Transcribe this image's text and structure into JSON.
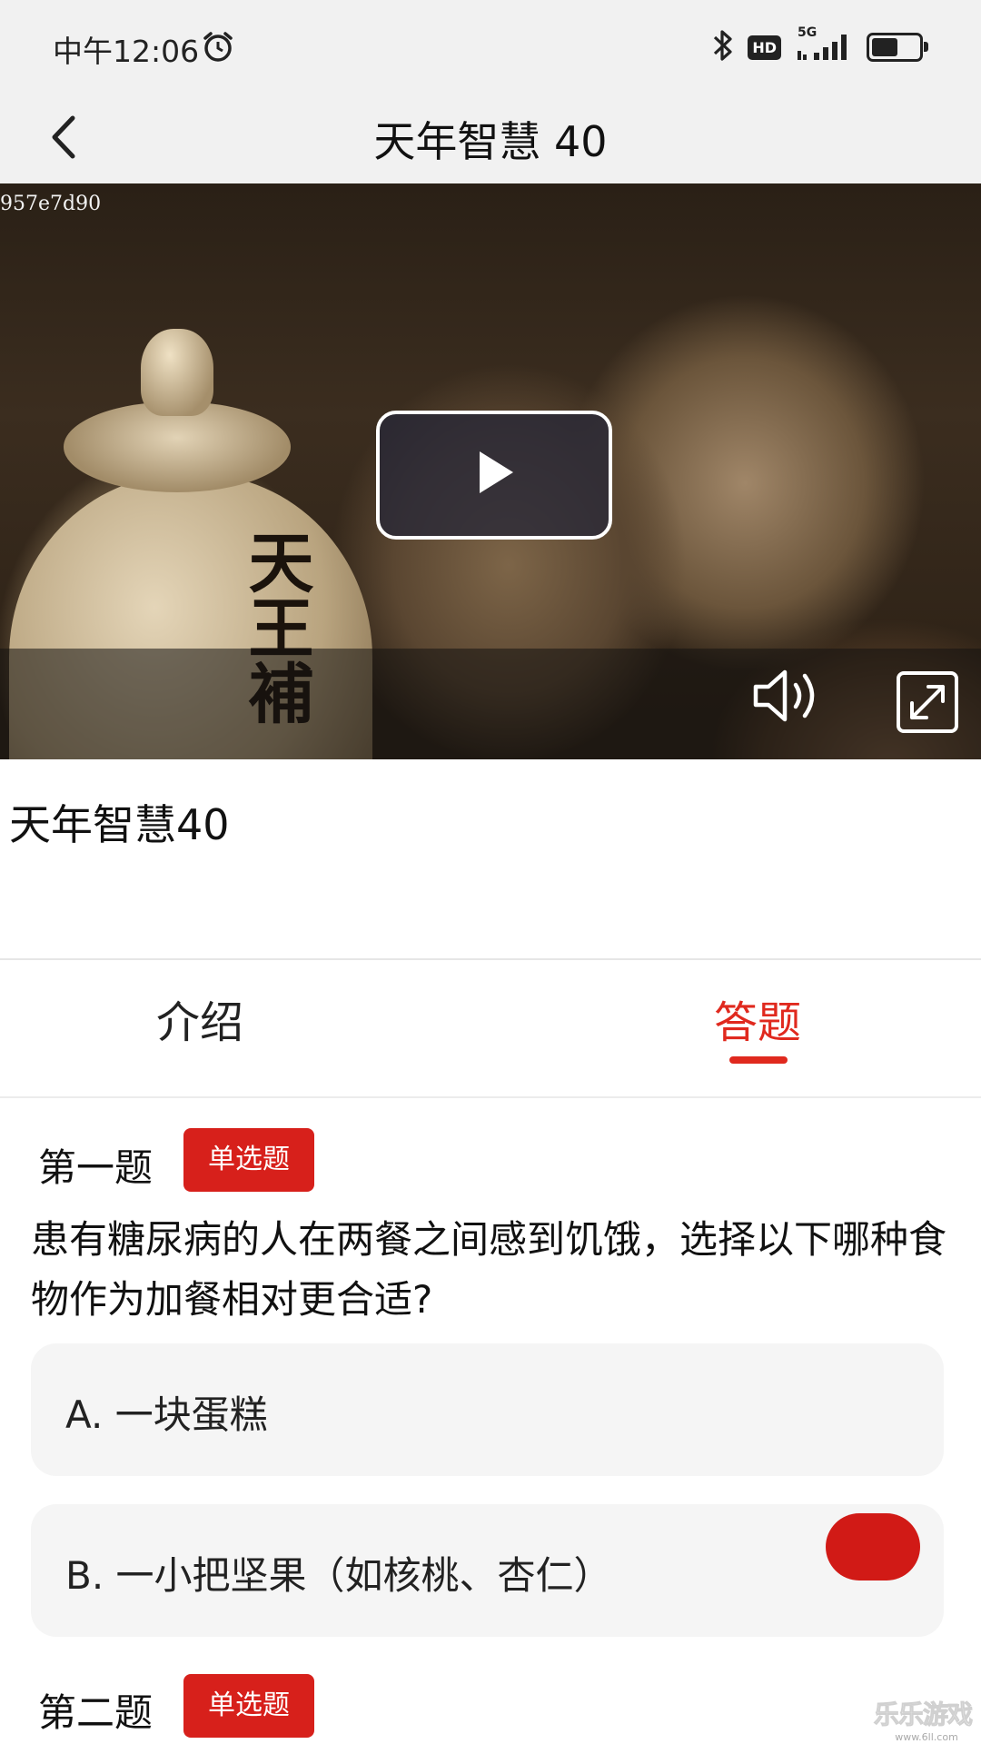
{
  "status_bar": {
    "time": "中午12:06",
    "hd": "HD",
    "network": "5G",
    "icons": [
      "alarm-icon",
      "bluetooth-icon",
      "hd-icon",
      "signal-5g-icon",
      "battery-icon"
    ],
    "battery_level": 0.55
  },
  "header": {
    "title": "天年智慧 40",
    "back_icon": "chevron-left-icon"
  },
  "video": {
    "overlay_code": "957e7d90",
    "jar_text": "天王補",
    "play_icon": "play-icon",
    "volume_icon": "volume-icon",
    "fullscreen_icon": "fullscreen-icon"
  },
  "video_title": "天年智慧40",
  "tabs": [
    {
      "label": "介绍",
      "active": false
    },
    {
      "label": "答题",
      "active": true
    }
  ],
  "questions": [
    {
      "number_label": "第一题",
      "type_badge": "单选题",
      "text": "患有糖尿病的人在两餐之间感到饥饿，选择以下哪种食物作为加餐相对更合适?",
      "options": [
        {
          "label": "A. 一块蛋糕",
          "selected": false
        },
        {
          "label": "B. 一小把坚果（如核桃、杏仁）",
          "selected": true
        }
      ]
    },
    {
      "number_label": "第二题",
      "type_badge": "单选题"
    }
  ],
  "watermark": {
    "text": "乐乐游戏",
    "sub": "www.6ll.com"
  },
  "colors": {
    "accent": "#e0291e",
    "badge": "#d7201b",
    "header_bg": "#f1f1f1",
    "option_bg": "#f5f5f5"
  }
}
